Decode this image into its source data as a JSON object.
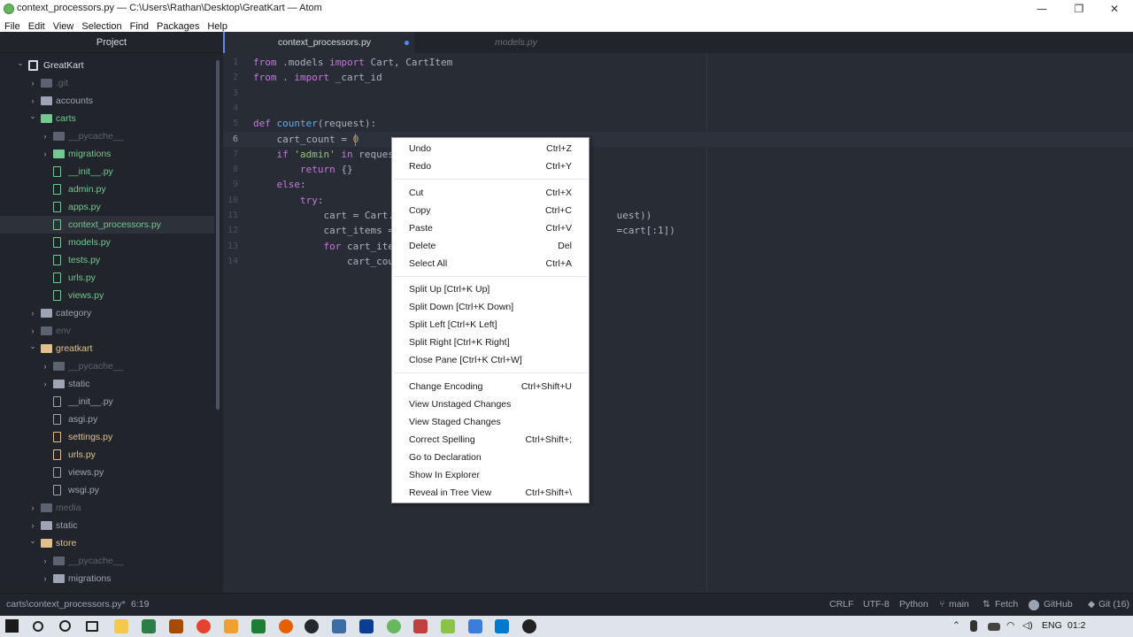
{
  "window": {
    "title": "context_processors.py — C:\\Users\\Rathan\\Desktop\\GreatKart — Atom",
    "minimize": "—",
    "maximize": "❐",
    "close": "✕"
  },
  "menu": [
    "File",
    "Edit",
    "View",
    "Selection",
    "Find",
    "Packages",
    "Help"
  ],
  "tree": {
    "header": "Project",
    "items": [
      {
        "label": "GreatKart",
        "kind": "repo",
        "arrow": "open",
        "color": "root"
      },
      {
        "label": ".git",
        "kind": "folder",
        "arrow": "closed",
        "color": "dim"
      },
      {
        "label": "accounts",
        "kind": "folder",
        "arrow": "closed",
        "color": "plain"
      },
      {
        "label": "carts",
        "kind": "folder",
        "arrow": "open",
        "color": "green"
      },
      {
        "label": "__pycache__",
        "kind": "folder",
        "arrow": "closed",
        "color": "dim"
      },
      {
        "label": "migrations",
        "kind": "folder",
        "arrow": "closed",
        "color": "green"
      },
      {
        "label": "__init__.py",
        "kind": "file",
        "arrow": "",
        "color": "green"
      },
      {
        "label": "admin.py",
        "kind": "file",
        "arrow": "",
        "color": "green"
      },
      {
        "label": "apps.py",
        "kind": "file",
        "arrow": "",
        "color": "green"
      },
      {
        "label": "context_processors.py",
        "kind": "file",
        "arrow": "",
        "color": "green",
        "selected": true
      },
      {
        "label": "models.py",
        "kind": "file",
        "arrow": "",
        "color": "green"
      },
      {
        "label": "tests.py",
        "kind": "file",
        "arrow": "",
        "color": "green"
      },
      {
        "label": "urls.py",
        "kind": "file",
        "arrow": "",
        "color": "green"
      },
      {
        "label": "views.py",
        "kind": "file",
        "arrow": "",
        "color": "green"
      },
      {
        "label": "category",
        "kind": "folder",
        "arrow": "closed",
        "color": "plain"
      },
      {
        "label": "env",
        "kind": "folder",
        "arrow": "closed",
        "color": "dim"
      },
      {
        "label": "greatkart",
        "kind": "folder",
        "arrow": "open",
        "color": "gold"
      },
      {
        "label": "__pycache__",
        "kind": "folder",
        "arrow": "closed",
        "color": "dim"
      },
      {
        "label": "static",
        "kind": "folder",
        "arrow": "closed",
        "color": "plain"
      },
      {
        "label": "__init__.py",
        "kind": "file",
        "arrow": "",
        "color": "plain"
      },
      {
        "label": "asgi.py",
        "kind": "file",
        "arrow": "",
        "color": "plain"
      },
      {
        "label": "settings.py",
        "kind": "file",
        "arrow": "",
        "color": "gold"
      },
      {
        "label": "urls.py",
        "kind": "file",
        "arrow": "",
        "color": "gold"
      },
      {
        "label": "views.py",
        "kind": "file",
        "arrow": "",
        "color": "plain"
      },
      {
        "label": "wsgi.py",
        "kind": "file",
        "arrow": "",
        "color": "plain"
      },
      {
        "label": "media",
        "kind": "folder",
        "arrow": "closed",
        "color": "dim"
      },
      {
        "label": "static",
        "kind": "folder",
        "arrow": "closed",
        "color": "plain"
      },
      {
        "label": "store",
        "kind": "folder",
        "arrow": "open",
        "color": "gold"
      },
      {
        "label": "__pycache__",
        "kind": "folder",
        "arrow": "closed",
        "color": "dim"
      },
      {
        "label": "migrations",
        "kind": "folder",
        "arrow": "closed",
        "color": "plain"
      }
    ]
  },
  "tabs": {
    "active": "context_processors.py",
    "inactive": "models.py"
  },
  "editor": {
    "cursor_line": 6,
    "lines": [
      [
        [
          "kw",
          "from"
        ],
        [
          "tx",
          " .models "
        ],
        [
          "kw",
          "import"
        ],
        [
          "tx",
          " Cart, CartItem"
        ]
      ],
      [
        [
          "kw",
          "from"
        ],
        [
          "tx",
          " . "
        ],
        [
          "kw",
          "import"
        ],
        [
          "tx",
          " _cart_id"
        ]
      ],
      [],
      [],
      [
        [
          "kw",
          "def"
        ],
        [
          "tx",
          " "
        ],
        [
          "fn",
          "counter"
        ],
        [
          "tx",
          "(request):"
        ]
      ],
      [
        [
          "tx",
          "    cart_count = "
        ],
        [
          "nm",
          "0"
        ]
      ],
      [
        [
          "tx",
          "    "
        ],
        [
          "kw",
          "if"
        ],
        [
          "tx",
          " "
        ],
        [
          "st",
          "'admin'"
        ],
        [
          "tx",
          " "
        ],
        [
          "kw",
          "in"
        ],
        [
          "tx",
          " request"
        ]
      ],
      [
        [
          "tx",
          "        "
        ],
        [
          "kw",
          "return"
        ],
        [
          "tx",
          " {}"
        ]
      ],
      [
        [
          "tx",
          "    "
        ],
        [
          "kw",
          "else"
        ],
        [
          "tx",
          ":"
        ]
      ],
      [
        [
          "tx",
          "        "
        ],
        [
          "kw",
          "try"
        ],
        [
          "tx",
          ":"
        ]
      ],
      [
        [
          "tx",
          "            cart = Cart.                                      uest))"
        ]
      ],
      [
        [
          "tx",
          "            cart_items =                                      =cart[:1])"
        ]
      ],
      [
        [
          "tx",
          "            "
        ],
        [
          "kw",
          "for"
        ],
        [
          "tx",
          " cart_ite"
        ]
      ],
      [
        [
          "tx",
          "                cart_cou"
        ]
      ]
    ]
  },
  "context_menu": [
    {
      "label": "Undo",
      "shortcut": "Ctrl+Z"
    },
    {
      "label": "Redo",
      "shortcut": "Ctrl+Y"
    },
    {
      "sep": true
    },
    {
      "label": "Cut",
      "shortcut": "Ctrl+X"
    },
    {
      "label": "Copy",
      "shortcut": "Ctrl+C"
    },
    {
      "label": "Paste",
      "shortcut": "Ctrl+V"
    },
    {
      "label": "Delete",
      "shortcut": "Del"
    },
    {
      "label": "Select All",
      "shortcut": "Ctrl+A"
    },
    {
      "sep": true
    },
    {
      "label": "Split Up [Ctrl+K Up]",
      "shortcut": ""
    },
    {
      "label": "Split Down [Ctrl+K Down]",
      "shortcut": ""
    },
    {
      "label": "Split Left [Ctrl+K Left]",
      "shortcut": ""
    },
    {
      "label": "Split Right [Ctrl+K Right]",
      "shortcut": ""
    },
    {
      "label": "Close Pane [Ctrl+K Ctrl+W]",
      "shortcut": ""
    },
    {
      "sep": true
    },
    {
      "label": "Change Encoding",
      "shortcut": "Ctrl+Shift+U"
    },
    {
      "label": "View Unstaged Changes",
      "shortcut": ""
    },
    {
      "label": "View Staged Changes",
      "shortcut": ""
    },
    {
      "label": "Correct Spelling",
      "shortcut": "Ctrl+Shift+;"
    },
    {
      "label": "Go to Declaration",
      "shortcut": ""
    },
    {
      "label": "Show In Explorer",
      "shortcut": ""
    },
    {
      "label": "Reveal in Tree View",
      "shortcut": "Ctrl+Shift+\\"
    }
  ],
  "statusbar": {
    "path": "carts\\context_processors.py*",
    "position": "6:19",
    "line_ending": "CRLF",
    "encoding": "UTF-8",
    "grammar": "Python",
    "branch": "main",
    "fetch": "Fetch",
    "github": "GitHub",
    "git": "Git (16)"
  },
  "taskbar": {
    "language": "ENG",
    "time": "01:2"
  },
  "colors": {
    "accent": "#528bff",
    "git_added": "#73c990",
    "git_modified": "#e2c08d"
  }
}
